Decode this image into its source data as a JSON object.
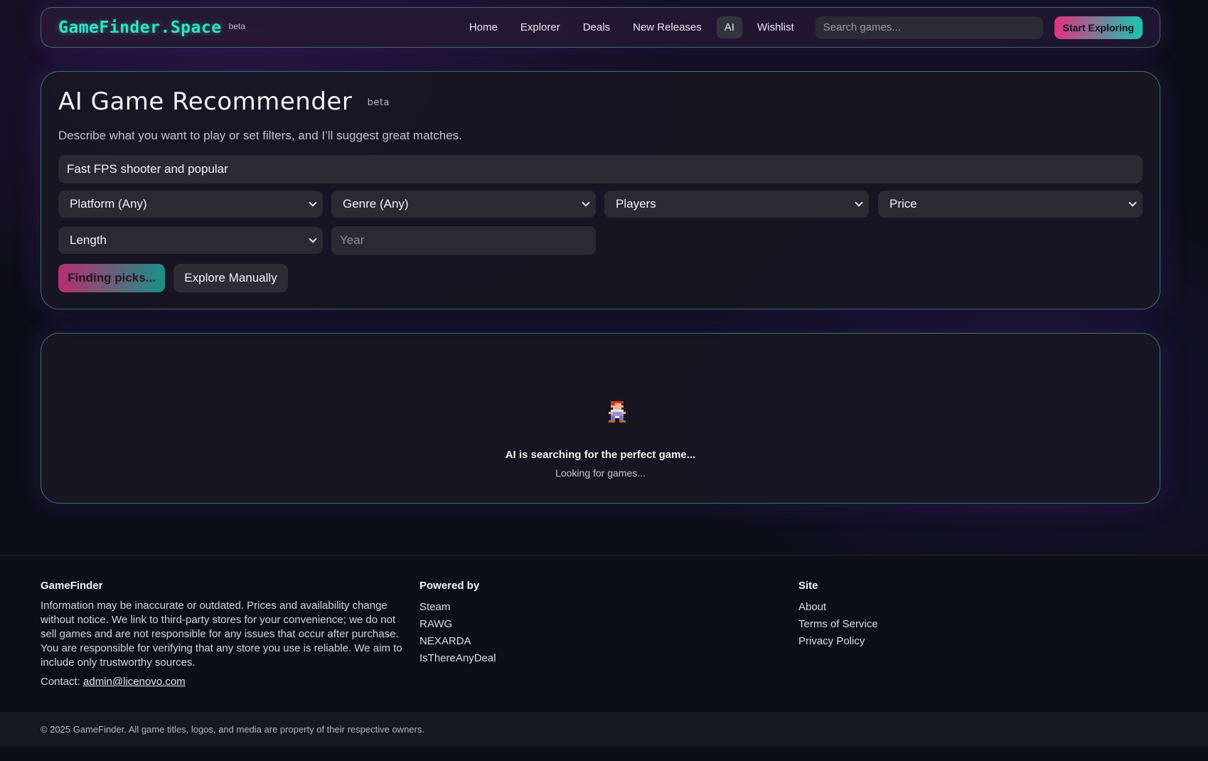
{
  "header": {
    "brand": "GameFinder.Space",
    "beta": "beta",
    "nav": [
      "Home",
      "Explorer",
      "Deals",
      "New Releases",
      "AI",
      "Wishlist"
    ],
    "active_nav": "AI",
    "search_placeholder": "Search games...",
    "cta": "Start Exploring"
  },
  "recommender": {
    "title": "AI Game Recommender",
    "beta": "beta",
    "description": "Describe what you want to play or set filters, and I’ll suggest great matches.",
    "prompt_value": "Fast FPS shooter and popular",
    "filters": {
      "platform": "Platform (Any)",
      "genre": "Genre (Any)",
      "players": "Players",
      "price": "Price",
      "length": "Length"
    },
    "year_placeholder": "Year",
    "find_button": "Finding picks...",
    "manual_button": "Explore Manually"
  },
  "results": {
    "status": "AI is searching for the perfect game...",
    "substatus": "Looking for games...",
    "sprite_icon": "pixel-character-icon"
  },
  "footer": {
    "about_title": "GameFinder",
    "about_text": "Information may be inaccurate or outdated. Prices and availability change without notice. We link to third-party stores for your convenience; we do not sell games and are not responsible for any issues that occur after purchase. You are responsible for verifying that any store you use is reliable. We aim to include only trustworthy sources.",
    "contact_label": "Contact:",
    "contact_email": "admin@licenovo.com",
    "powered_title": "Powered by",
    "powered": [
      "Steam",
      "RAWG",
      "NEXARDA",
      "IsThereAnyDeal"
    ],
    "site_title": "Site",
    "site_links": [
      "About",
      "Terms of Service",
      "Privacy Policy"
    ],
    "copyright": "© 2025 GameFinder. All game titles, logos, and media are property of their respective owners."
  },
  "colors": {
    "brand": "#2ee5c6",
    "accent_pink": "#e0337f",
    "accent_teal": "#17c7b1",
    "background": "#0d0d18"
  }
}
